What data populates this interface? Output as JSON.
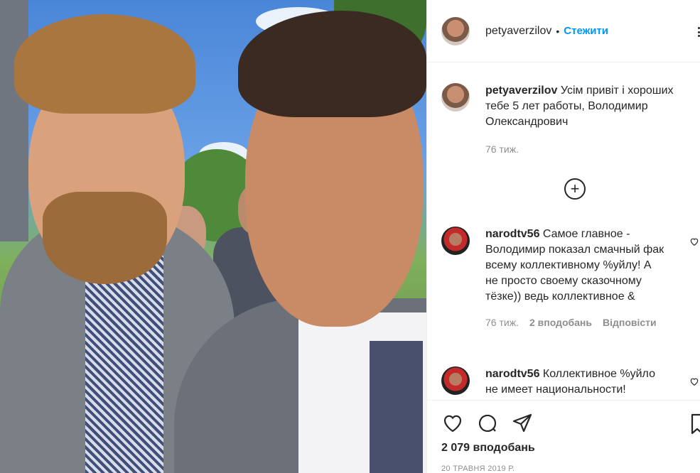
{
  "post": {
    "author": "petyaverzilov",
    "follow_label": "Стежити",
    "separator": "•",
    "caption_text": "Усім привіт і хороших тебе 5 лет работы, Володимир Олександрович",
    "caption_age": "76 тиж.",
    "likes": "2 079 вподобань",
    "date": "20 ТРАВНЯ 2019 Р."
  },
  "comments": [
    {
      "user": "narodtv56",
      "text": "Самое главное - Володимир показал смачный фак всему коллективному %уйлу! А не просто своему сказочному тёзке)) ведь коллективное &",
      "age": "76 тиж.",
      "likes": "2 вподобань",
      "reply": "Відповісти"
    },
    {
      "user": "narodtv56",
      "text": "Коллективное %уйло не имеет национальности!"
    }
  ],
  "icons": {
    "more": "more-options-icon",
    "load_more": "plus-circle-icon",
    "like": "heart-icon",
    "comment": "comment-icon",
    "share": "share-icon",
    "save": "bookmark-icon"
  },
  "colors": {
    "accent": "#0095f6",
    "text": "#262626",
    "muted": "#8e8e8e",
    "border": "#efefef"
  }
}
